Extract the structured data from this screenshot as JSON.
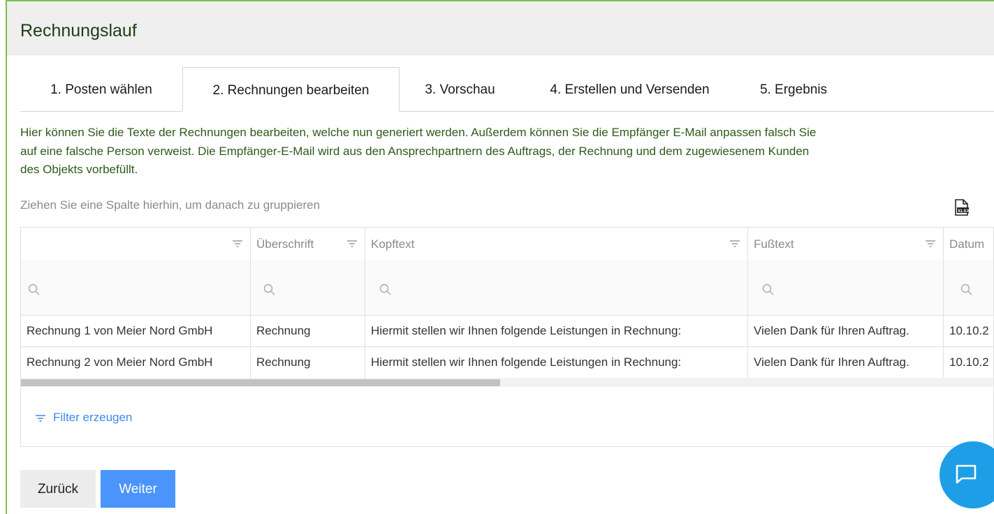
{
  "header": {
    "title": "Rechnungslauf"
  },
  "tabs": [
    {
      "label": "1. Posten wählen"
    },
    {
      "label": "2. Rechnungen bearbeiten",
      "active": true
    },
    {
      "label": "3. Vorschau"
    },
    {
      "label": "4. Erstellen und Versenden"
    },
    {
      "label": "5. Ergebnis"
    }
  ],
  "info": {
    "line1": "Hier können Sie die Texte der Rechnungen bearbeiten, welche nun generiert werden. Außerdem können Sie die Empfänger E-Mail anpassen falsch Sie",
    "line2": "auf eine falsche Person verweist. Die Empfänger-E-Mail wird aus den Ansprechpartnern des Auftrags, der Rechnung und dem zugewiesenem Kunden",
    "line3": "des Objekts vorbefüllt."
  },
  "grid": {
    "group_hint": "Ziehen Sie eine Spalte hierhin, um danach zu gruppieren",
    "export_icon": "xlsx-export-icon",
    "columns": [
      "",
      "Überschrift",
      "Kopftext",
      "Fußtext",
      "Datum"
    ],
    "rows": [
      [
        "Rechnung 1 von Meier Nord GmbH",
        "Rechnung",
        "Hiermit stellen wir Ihnen folgende Leistungen in Rechnung:",
        "Vielen Dank für Ihren Auftrag.",
        "10.10.2"
      ],
      [
        "Rechnung 2 von Meier Nord GmbH",
        "Rechnung",
        "Hiermit stellen wir Ihnen folgende Leistungen in Rechnung:",
        "Vielen Dank für Ihren Auftrag.",
        "10.10.2"
      ]
    ],
    "filter_link": "Filter erzeugen"
  },
  "buttons": {
    "back": "Zurück",
    "next": "Weiter"
  },
  "colors": {
    "accent_green": "#7cc04a",
    "primary_blue": "#4b94fb",
    "link_blue": "#3d8af0",
    "chat_blue": "#1e9ee6",
    "text_green": "#2d5a1a"
  }
}
